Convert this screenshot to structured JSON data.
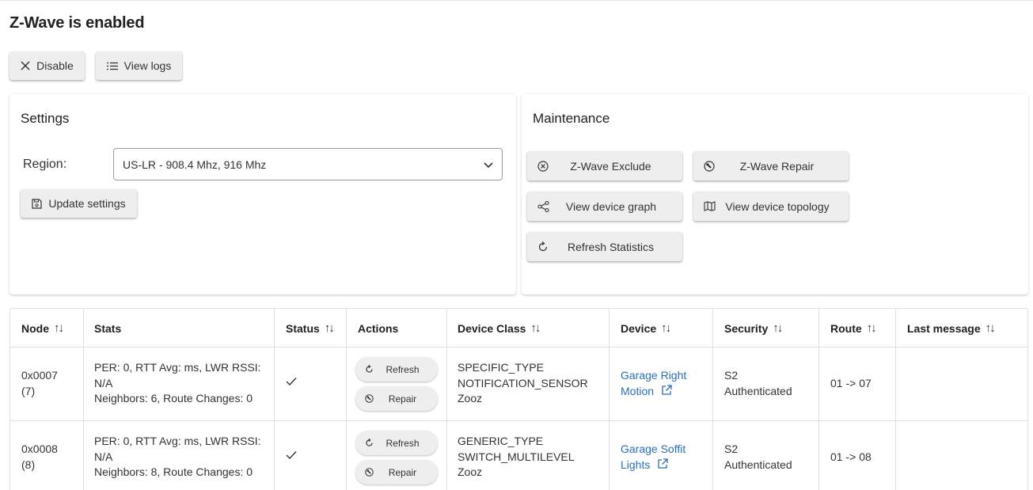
{
  "page": {
    "title": "Z-Wave is enabled"
  },
  "top_buttons": {
    "disable": "Disable",
    "view_logs": "View logs"
  },
  "settings": {
    "title": "Settings",
    "region_label": "Region:",
    "region_value": "US-LR - 908.4 Mhz, 916 Mhz",
    "update_button": "Update settings"
  },
  "maintenance": {
    "title": "Maintenance",
    "exclude": "Z-Wave Exclude",
    "repair": "Z-Wave Repair",
    "graph": "View device graph",
    "topology": "View device topology",
    "refresh_stats": "Refresh Statistics"
  },
  "table": {
    "headers": [
      "Node",
      "Stats",
      "Status",
      "Actions",
      "Device Class",
      "Device",
      "Security",
      "Route",
      "Last message"
    ],
    "sort_glyph": "↑↓",
    "rows": [
      {
        "node_line1": "0x0007",
        "node_line2": "(7)",
        "stats_line1": "PER: 0, RTT Avg: ms, LWR RSSI:",
        "stats_line2": "N/A",
        "stats_line3": "Neighbors: 6, Route Changes: 0",
        "status": "✓",
        "refresh": "Refresh",
        "repair": "Repair",
        "class_line1": "SPECIFIC_TYPE",
        "class_line2": "NOTIFICATION_SENSOR",
        "class_line3": "Zooz",
        "device_line1": "Garage Right",
        "device_line2": "Motion",
        "security_line1": "S2",
        "security_line2": "Authenticated",
        "route": "01 -> 07",
        "last_message": ""
      },
      {
        "node_line1": "0x0008",
        "node_line2": "(8)",
        "stats_line1": "PER: 0, RTT Avg: ms, LWR RSSI:",
        "stats_line2": "N/A",
        "stats_line3": "Neighbors: 8, Route Changes: 0",
        "status": "✓",
        "refresh": "Refresh",
        "repair": "Repair",
        "class_line1": "GENERIC_TYPE",
        "class_line2": "SWITCH_MULTILEVEL",
        "class_line3": "Zooz",
        "device_line1": "Garage Soffit",
        "device_line2": "Lights",
        "security_line1": "S2",
        "security_line2": "Authenticated",
        "route": "01 -> 08",
        "last_message": ""
      }
    ]
  },
  "icons": {
    "disable": "close-icon",
    "logs": "list-icon",
    "save": "floppy-icon",
    "exclude": "circle-x-icon",
    "repair": "wrench-circle-icon",
    "graph": "share-icon",
    "topology": "map-icon",
    "refresh": "refresh-icon",
    "external": "external-link-icon",
    "dropdown": "chevron-down-icon",
    "status": "check-icon"
  },
  "colors": {
    "link": "#2a6fb6",
    "button_bg": "#eeeeee",
    "border": "#e0e0e0"
  }
}
